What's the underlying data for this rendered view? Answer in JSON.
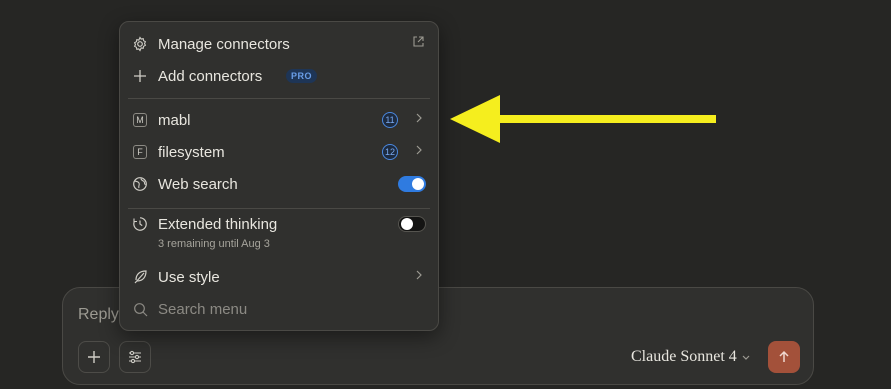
{
  "menu": {
    "manage_connectors": "Manage connectors",
    "add_connectors": "Add connectors",
    "pro_badge": "PRO",
    "connectors": [
      {
        "letter": "M",
        "label": "mabl",
        "count": "11"
      },
      {
        "letter": "F",
        "label": "filesystem",
        "count": "12"
      }
    ],
    "web_search": {
      "label": "Web search",
      "enabled": true
    },
    "extended_thinking": {
      "label": "Extended thinking",
      "sublabel": "3 remaining until Aug 3",
      "enabled": false
    },
    "use_style": "Use style",
    "search_placeholder": "Search menu"
  },
  "composer": {
    "placeholder": "Reply",
    "model": "Claude Sonnet 4"
  },
  "colors": {
    "accent_blue": "#2f7be0",
    "send_button": "#a3513a",
    "annotation_arrow": "#f5ee1e"
  },
  "icons": [
    "gear-icon",
    "external-link-icon",
    "plus-icon",
    "chevron-right-icon",
    "globe-icon",
    "clock-icon",
    "feather-icon",
    "search-icon",
    "sliders-icon",
    "arrow-up-icon",
    "chevron-down-icon"
  ]
}
